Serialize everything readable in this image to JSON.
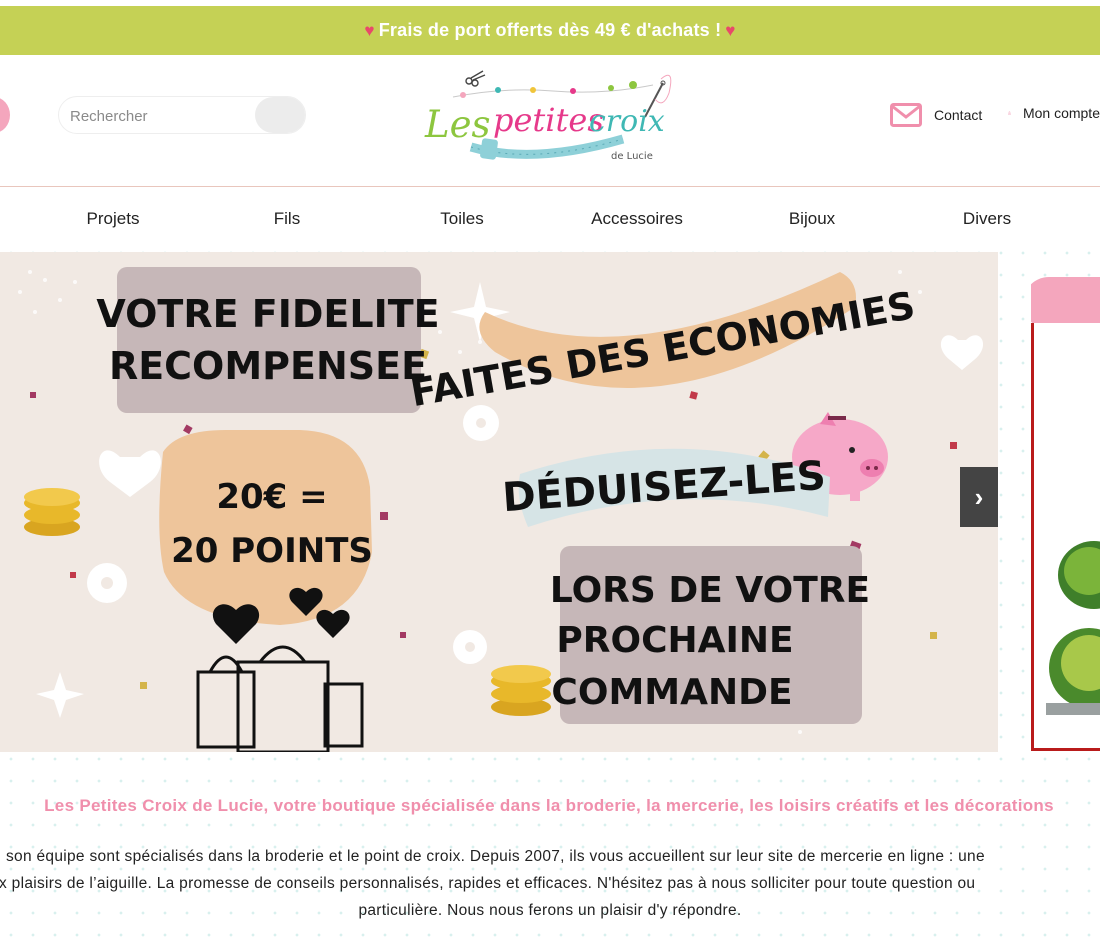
{
  "promo": {
    "text": "Frais de port offerts dès 49 € d'achats !",
    "heart": "♥"
  },
  "header": {
    "search_placeholder": "Rechercher",
    "logo": {
      "main": "Les petites croix",
      "sub": "de Lucie"
    },
    "contact_label": "Contact",
    "account_label": "Mon compte"
  },
  "nav": [
    "Projets",
    "Fils",
    "Toiles",
    "Accessoires",
    "Bijoux",
    "Divers"
  ],
  "banner": {
    "fidelite": [
      "VOTRE FIDELITE",
      "RECOMPENSEE"
    ],
    "points": [
      "20€ =",
      "20 POINTS"
    ],
    "economies": "FAITES DES ECONOMIES",
    "deduisez": "DÉDUISEZ-LES",
    "commande": [
      "LORS DE VOTRE",
      "PROCHAINE",
      "COMMANDE"
    ],
    "next_arrow": "›"
  },
  "tagline": "Les Petites Croix de Lucie, votre boutique spécialisée dans la broderie, la mercerie, les loisirs créatifs et les décorations",
  "about": {
    "line1": "son équipe sont spécialisés dans la broderie et le point de croix. Depuis 2007, ils vous accueillent sur leur site de mercerie en ligne : une",
    "line2": "x plaisirs de l’aiguille. La promesse de conseils personnalisés, rapides et efficaces. N'hésitez pas à nous solliciter pour toute question ou",
    "line3": "particulière. Nous nous ferons un plaisir d'y répondre."
  },
  "colors": {
    "promo_bg": "#c5d155",
    "accent_pink": "#f4a6bd",
    "heart_red": "#e8496a",
    "logo_green": "#8dc63f",
    "logo_pink": "#e6398a",
    "logo_teal": "#3fb8b4",
    "banner_bg": "#f1e9e3"
  }
}
